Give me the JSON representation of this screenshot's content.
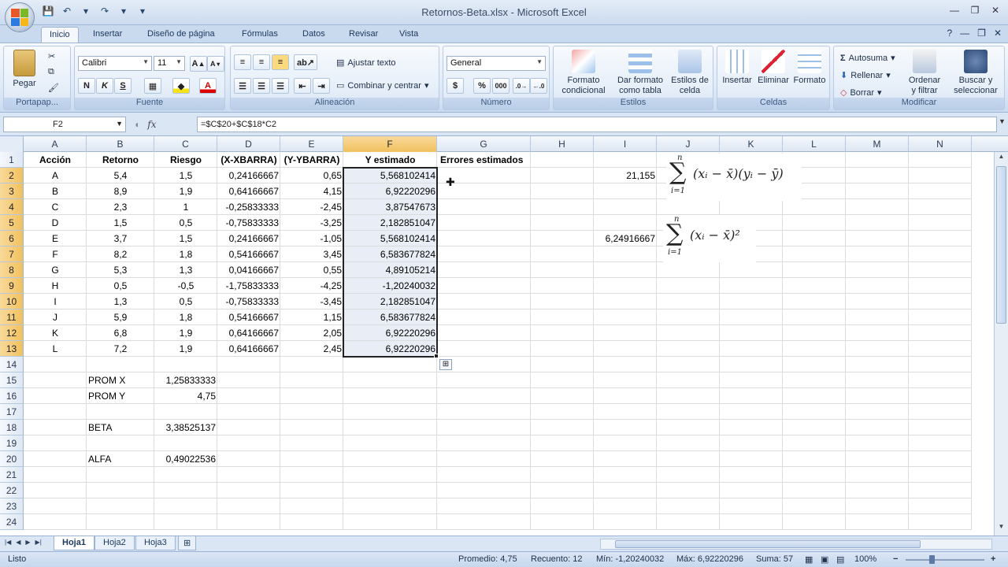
{
  "window": {
    "title": "Retornos-Beta.xlsx - Microsoft Excel",
    "controls": [
      "—",
      "❐",
      "✕"
    ],
    "ribbon_controls": [
      "?",
      "—",
      "❐",
      "✕"
    ]
  },
  "qat": [
    "💾",
    "↶",
    "▾",
    "↷",
    "▾",
    "▾"
  ],
  "tabs": [
    "Inicio",
    "Insertar",
    "Diseño de página",
    "Fórmulas",
    "Datos",
    "Revisar",
    "Vista"
  ],
  "ribbon": {
    "portapapeles": {
      "label": "Portapap...",
      "pegar": "Pegar"
    },
    "fuente": {
      "label": "Fuente",
      "font": "Calibri",
      "size": "11",
      "bold": "N",
      "italic": "K",
      "underline": "S"
    },
    "alineacion": {
      "label": "Alineación",
      "wrap": "Ajustar texto",
      "merge": "Combinar y centrar"
    },
    "numero": {
      "label": "Número",
      "format": "General",
      "currency": "$",
      "percent": "%",
      "thousands": "000"
    },
    "estilos": {
      "label": "Estilos",
      "cond_1": "Formato",
      "cond_2": "condicional",
      "table_1": "Dar formato",
      "table_2": "como tabla",
      "cell_1": "Estilos de",
      "cell_2": "celda"
    },
    "celdas": {
      "label": "Celdas",
      "insert": "Insertar",
      "delete": "Eliminar",
      "format": "Formato"
    },
    "modificar": {
      "label": "Modificar",
      "autosum": "Autosuma",
      "fill": "Rellenar",
      "clear": "Borrar",
      "sort_1": "Ordenar",
      "sort_2": "y filtrar",
      "find_1": "Buscar y",
      "find_2": "seleccionar"
    }
  },
  "formula_bar": {
    "name_box": "F2",
    "fx": "fx",
    "formula": "=$C$20+$C$18*C2"
  },
  "columns": [
    "A",
    "B",
    "C",
    "D",
    "E",
    "F",
    "G",
    "H",
    "I",
    "J",
    "K",
    "L",
    "M",
    "N"
  ],
  "rows": [
    "1",
    "2",
    "3",
    "4",
    "5",
    "6",
    "7",
    "8",
    "9",
    "10",
    "11",
    "12",
    "13",
    "14",
    "15",
    "16",
    "17",
    "18",
    "19",
    "20",
    "21",
    "22",
    "23",
    "24"
  ],
  "headers_row": [
    "Acción",
    "Retorno",
    "Riesgo",
    "(X-XBARRA)",
    "(Y-YBARRA)",
    "Y estimado",
    "Errores estimados"
  ],
  "table": [
    [
      "A",
      "5,4",
      "1,5",
      "0,24166667",
      "0,65",
      "5,568102414"
    ],
    [
      "B",
      "8,9",
      "1,9",
      "0,64166667",
      "4,15",
      "6,92220296"
    ],
    [
      "C",
      "2,3",
      "1",
      "-0,25833333",
      "-2,45",
      "3,87547673"
    ],
    [
      "D",
      "1,5",
      "0,5",
      "-0,75833333",
      "-3,25",
      "2,182851047"
    ],
    [
      "E",
      "3,7",
      "1,5",
      "0,24166667",
      "-1,05",
      "5,568102414"
    ],
    [
      "F",
      "8,2",
      "1,8",
      "0,54166667",
      "3,45",
      "6,583677824"
    ],
    [
      "G",
      "5,3",
      "1,3",
      "0,04166667",
      "0,55",
      "4,89105214"
    ],
    [
      "H",
      "0,5",
      "-0,5",
      "-1,75833333",
      "-4,25",
      "-1,20240032"
    ],
    [
      "I",
      "1,3",
      "0,5",
      "-0,75833333",
      "-3,45",
      "2,182851047"
    ],
    [
      "J",
      "5,9",
      "1,8",
      "0,54166667",
      "1,15",
      "6,583677824"
    ],
    [
      "K",
      "6,8",
      "1,9",
      "0,64166667",
      "2,05",
      "6,92220296"
    ],
    [
      "L",
      "7,2",
      "1,9",
      "0,64166667",
      "2,45",
      "6,92220296"
    ]
  ],
  "summary": {
    "prom_x_label": "PROM X",
    "prom_x": "1,25833333",
    "prom_y_label": "PROM Y",
    "prom_y": "4,75",
    "beta_label": "BETA",
    "beta": "3,38525137",
    "alfa_label": "ALFA",
    "alfa": "0,49022536"
  },
  "side_values": {
    "sxy": "21,155",
    "sxx": "6,24916667"
  },
  "formulas": {
    "sum_upper": "n",
    "sum_lower": "i=1",
    "sigma": "∑",
    "sxy_body": "(xᵢ − x̄)(yᵢ − ȳ)",
    "sxx_body": "(xᵢ − x̄)²"
  },
  "sheets": [
    "Hoja1",
    "Hoja2",
    "Hoja3"
  ],
  "status": {
    "mode": "Listo",
    "average": "Promedio: 4,75",
    "count": "Recuento: 12",
    "min": "Mín: -1,20240032",
    "max": "Máx: 6,92220296",
    "sum": "Suma: 57",
    "zoom": "100%"
  }
}
